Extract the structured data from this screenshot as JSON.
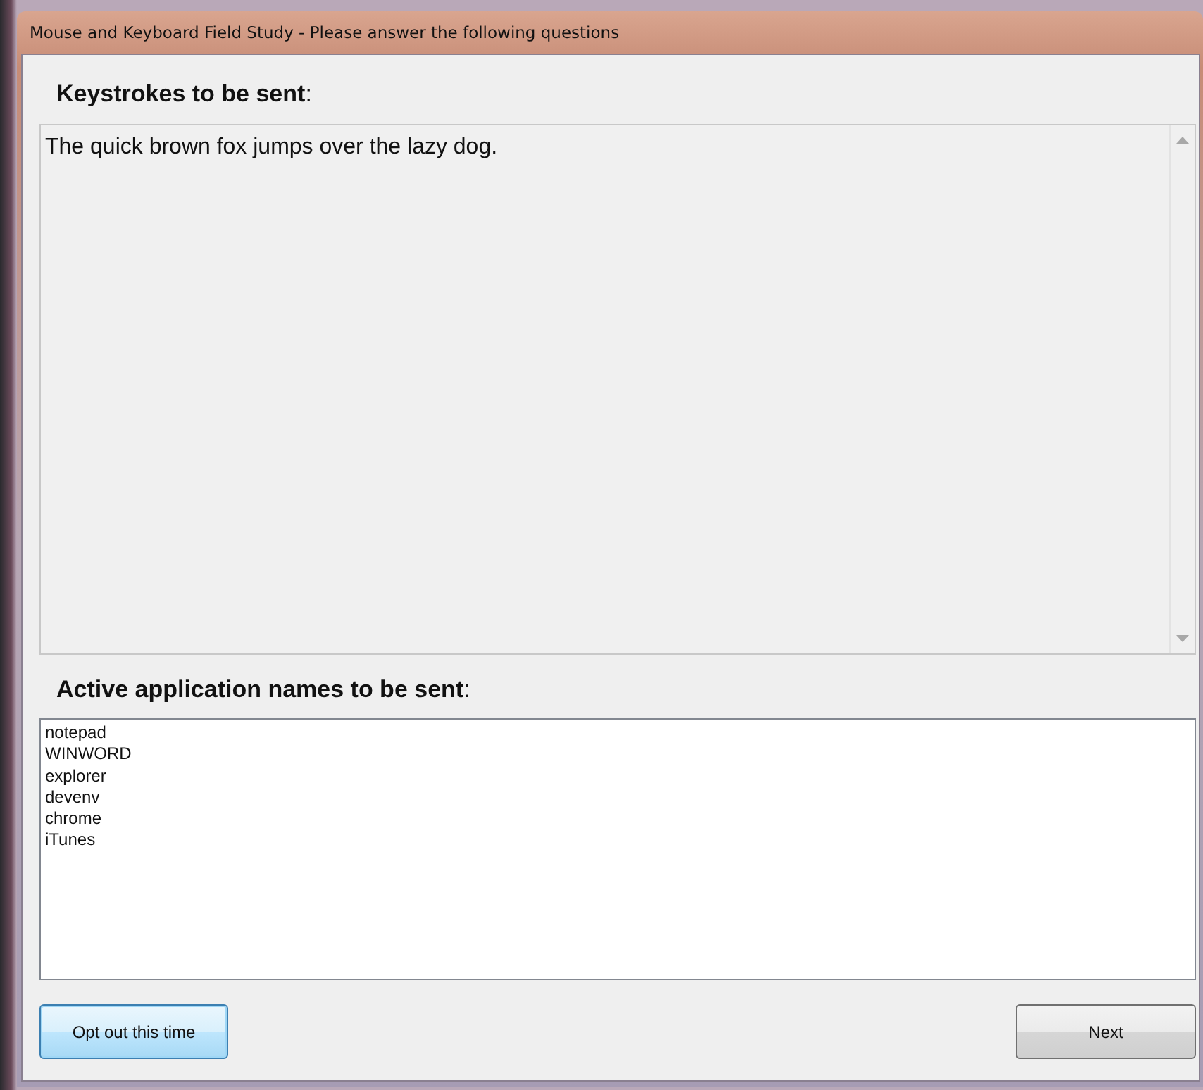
{
  "window": {
    "title": "Mouse and Keyboard Field Study - Please answer the following questions"
  },
  "keystrokes": {
    "heading": "**Keystrokes to be sent**:",
    "value": "The quick brown fox jumps over the lazy dog."
  },
  "applications": {
    "heading": "**Active application names to be sent**:",
    "names": [
      "notepad",
      "WINWORD",
      "explorer",
      "devenv",
      "chrome",
      "iTunes"
    ]
  },
  "buttons": [
    {
      "label": "Opt out this time",
      "focused": true
    },
    {
      "label": "Next",
      "focused": false
    }
  ]
}
